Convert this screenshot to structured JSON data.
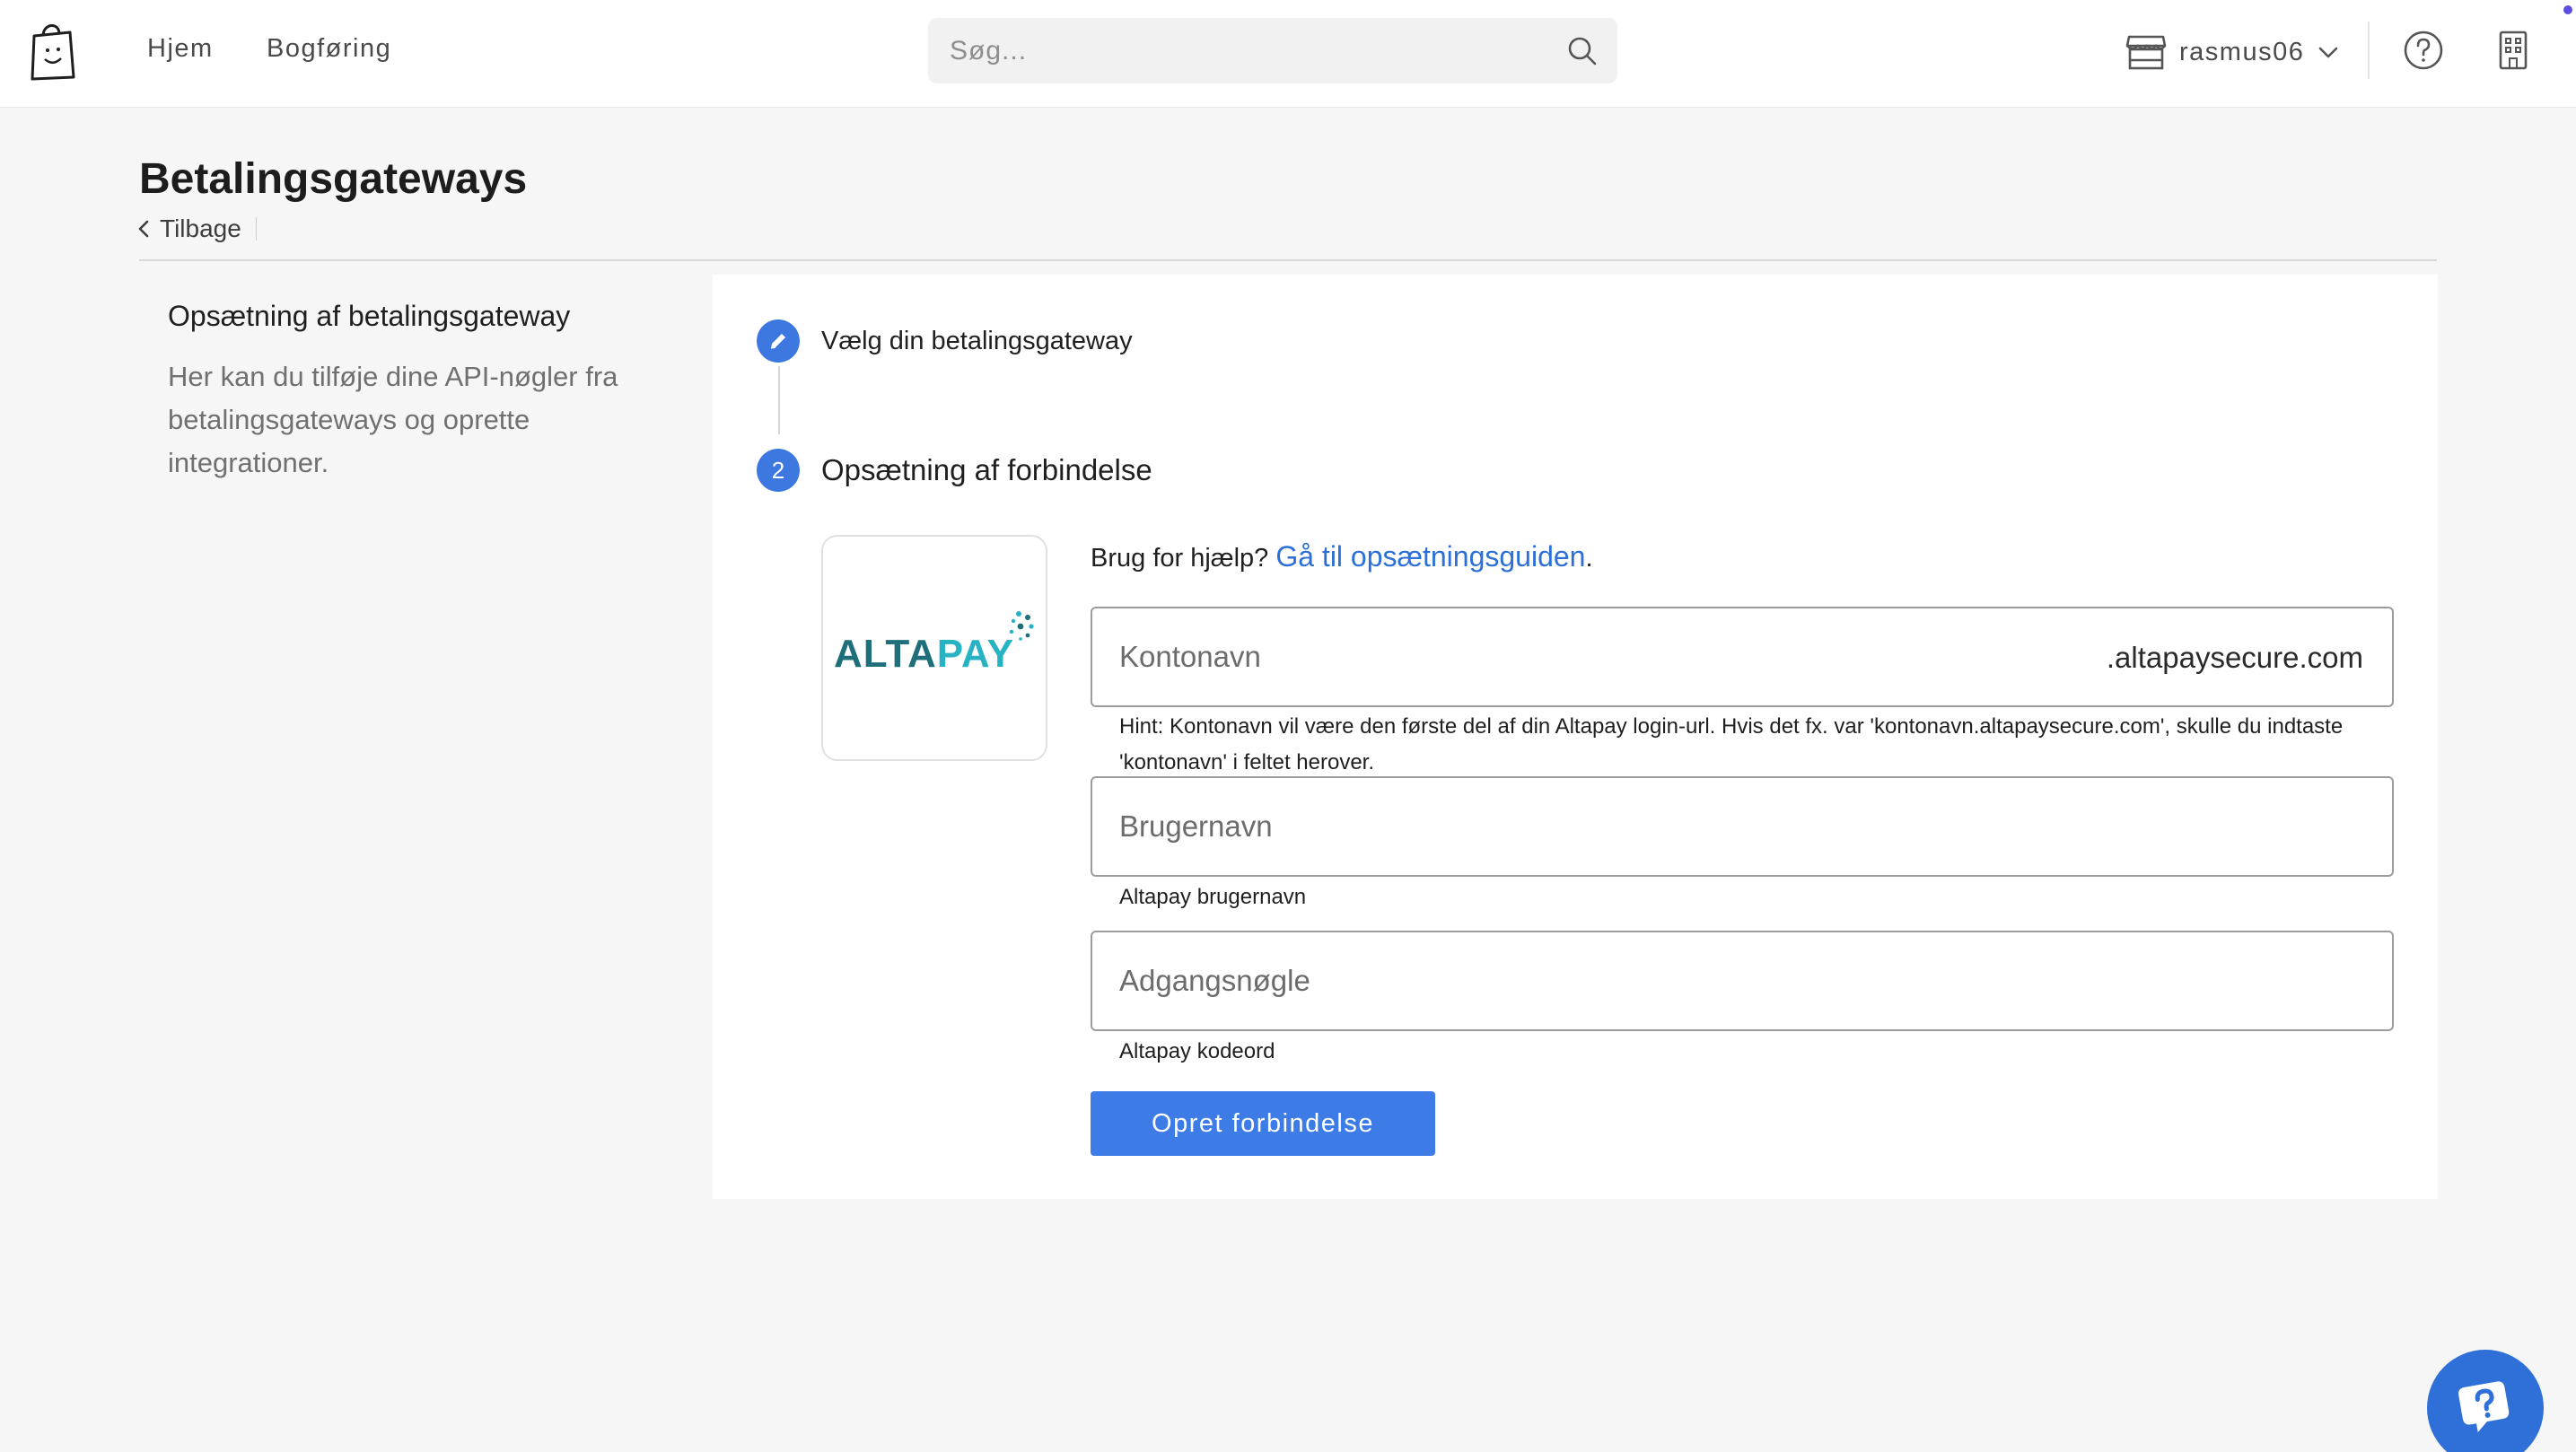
{
  "nav": {
    "home": "Hjem",
    "bookkeeping": "Bogføring",
    "search_placeholder": "Søg...",
    "account_name": "rasmus06"
  },
  "page": {
    "title": "Betalingsgateways",
    "back_label": "Tilbage"
  },
  "sidebar": {
    "title": "Opsætning af betalingsgateway",
    "description": "Her kan du tilføje dine API-nøgler fra betalingsgateways og oprette integrationer."
  },
  "steps": [
    {
      "number": "",
      "icon": "pencil-icon",
      "label": "Vælg din betalingsgateway"
    },
    {
      "number": "2",
      "label": "Opsætning af forbindelse"
    }
  ],
  "gateway": {
    "logo_text_a": "ALTA",
    "logo_text_b": "PAY"
  },
  "help": {
    "prefix": "Brug for hjælp?",
    "link": "Gå til opsætningsguiden",
    "suffix": "."
  },
  "form": {
    "account": {
      "placeholder": "Kontonavn",
      "suffix": ".altapaysecure.com",
      "hint": "Hint: Kontonavn vil være den første del af din Altapay login-url. Hvis det fx. var 'kontonavn.altapaysecure.com', skulle du indtaste 'kontonavn' i feltet herover."
    },
    "username": {
      "placeholder": "Brugernavn",
      "hint": "Altapay brugernavn"
    },
    "password": {
      "placeholder": "Adgangsnøgle",
      "hint": "Altapay kodeord"
    },
    "submit_label": "Opret forbindelse"
  },
  "colors": {
    "accent": "#3d7be6",
    "link": "#2c6fd6",
    "logo_dark": "#1f6f7a",
    "logo_light": "#28b3c4"
  }
}
